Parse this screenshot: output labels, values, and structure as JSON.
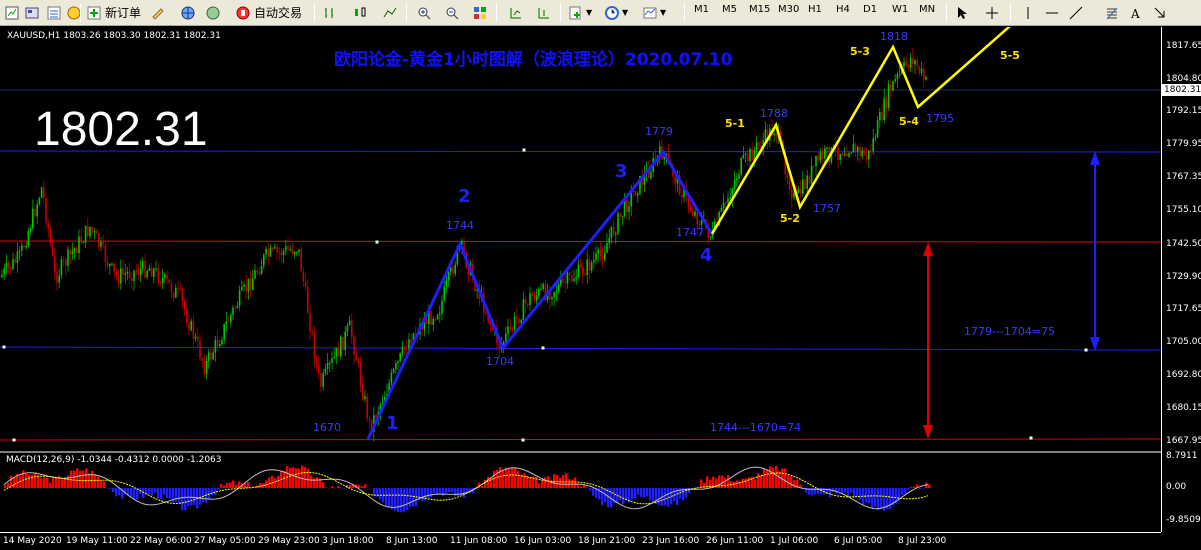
{
  "toolbar": {
    "new_order": "新订单",
    "auto_trading": "自动交易",
    "timeframes": [
      "M1",
      "M5",
      "M15",
      "M30",
      "H1",
      "H4",
      "D1",
      "W1",
      "MN"
    ]
  },
  "chart": {
    "symbol_info": "XAUUSD,H1  1803.26 1803.30 1802.31 1802.31",
    "title": "欧阳论金-黄金1小时图解（波浪理论）2020.07.10",
    "big_price": "1802.31",
    "current_price_tag": "1802.31",
    "price_ticks": [
      "1817.65",
      "1804.80",
      "1792.15",
      "1779.95",
      "1767.35",
      "1755.10",
      "1742.50",
      "1729.90",
      "1717.65",
      "1705.00",
      "1692.80",
      "1680.15",
      "1667.95"
    ],
    "macd_label": "MACD(12,26,9) -1.0344 -0.4312 0.0000 -1.2063",
    "macd_ticks": [
      "8.7911",
      "0.00",
      "-9.8509"
    ],
    "time_ticks": [
      "14 May 2020",
      "19 May 11:00",
      "22 May 06:00",
      "27 May 05:00",
      "29 May 23:00",
      "3 Jun 18:00",
      "8 Jun 13:00",
      "11 Jun 08:00",
      "16 Jun 03:00",
      "18 Jun 21:00",
      "23 Jun 16:00",
      "26 Jun 11:00",
      "1 Jul 06:00",
      "6 Jul 05:00",
      "8 Jul 23:00"
    ],
    "wave_labels": {
      "w1": "1",
      "w2": "2",
      "w3": "3",
      "w4": "4",
      "p1670": "1670",
      "p1744": "1744",
      "p1704": "1704",
      "p1779": "1779",
      "p1747": "1747",
      "p1788": "1788",
      "p1757": "1757",
      "p1818": "1818",
      "p1795": "1795",
      "s51": "5-1",
      "s52": "5-2",
      "s53": "5-3",
      "s54": "5-4",
      "s55": "5-5"
    },
    "measure_blue": "1779---1704=75",
    "measure_red": "1744---1670=74",
    "colors": {
      "bull": "#00C800",
      "bear": "#C80000",
      "wave_blue": "#1E1EFF",
      "wave_yellow": "#FFFF00",
      "h_blue": "#1E1EFF",
      "h_red": "#E00000"
    }
  }
}
